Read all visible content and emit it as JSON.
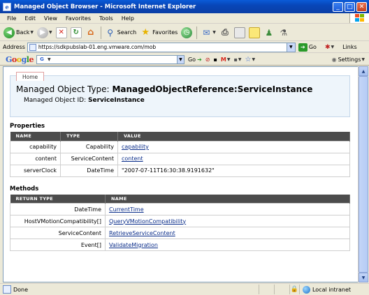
{
  "window": {
    "title": "Managed Object Browser - Microsoft Internet Explorer"
  },
  "menubar": {
    "items": [
      "File",
      "Edit",
      "View",
      "Favorites",
      "Tools",
      "Help"
    ]
  },
  "toolbar": {
    "back_label": "Back",
    "search_label": "Search",
    "favorites_label": "Favorites"
  },
  "address": {
    "label": "Address",
    "url": "https://sdkpubslab-01.eng.vmware.com/mob",
    "go_label": "Go",
    "links_label": "Links"
  },
  "google": {
    "logo": "Google",
    "go_label": "Go",
    "settings_label": "Settings"
  },
  "page": {
    "home_tab": "Home",
    "mo_type_prefix": "Managed Object Type:",
    "mo_type_value": "ManagedObjectReference:ServiceInstance",
    "mo_id_prefix": "Managed Object ID:",
    "mo_id_value": "ServiceInstance",
    "properties": {
      "title": "Properties",
      "headers": [
        "NAME",
        "TYPE",
        "VALUE"
      ],
      "rows": [
        {
          "name": "capability",
          "type": "Capability",
          "value": "capability"
        },
        {
          "name": "content",
          "type": "ServiceContent",
          "value": "content"
        },
        {
          "name": "serverClock",
          "type": "DateTime",
          "value": "\"2007-07-11T16:30:38.9191632\""
        }
      ]
    },
    "methods": {
      "title": "Methods",
      "headers": [
        "RETURN TYPE",
        "NAME"
      ],
      "rows": [
        {
          "return_type": "DateTime",
          "name": "CurrentTime"
        },
        {
          "return_type": "HostVMotionCompatibility[]",
          "name": "QueryVMotionCompatibility"
        },
        {
          "return_type": "ServiceContent",
          "name": "RetrieveServiceContent"
        },
        {
          "return_type": "Event[]",
          "name": "ValidateMigration"
        }
      ]
    }
  },
  "status": {
    "text": "Done",
    "zone": "Local intranet"
  },
  "colors": {
    "title_bar": "#0a4fc8",
    "table_header": "#4c4c4c",
    "link": "#0a2d8a",
    "header_box": "#eef5fb"
  }
}
